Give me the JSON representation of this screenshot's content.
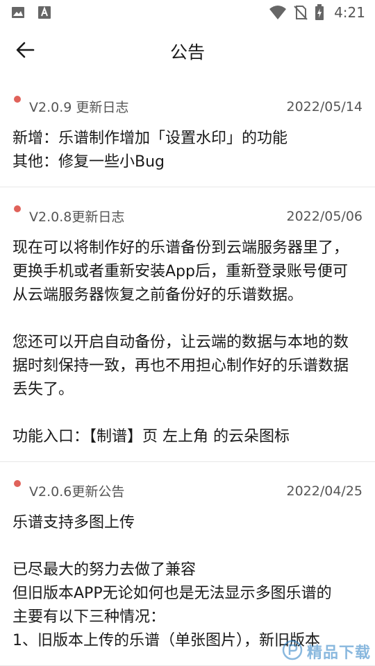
{
  "status_bar": {
    "time": "4:21",
    "icons": [
      "image-icon",
      "a-icon",
      "wifi-icon",
      "no-sim-icon",
      "battery-charging-icon"
    ]
  },
  "header": {
    "title": "公告"
  },
  "notices": [
    {
      "title": "V2.0.9 更新日志",
      "date": "2022/05/14",
      "lines": [
        "新增：乐谱制作增加「设置水印」的功能",
        "其他：修复一些小Bug"
      ]
    },
    {
      "title": "V2.0.8更新日志",
      "date": "2022/05/06",
      "lines": [
        "现在可以将制作好的乐谱备份到云端服务器里了，更换手机或者重新安装App后，重新登录账号便可从云端服务器恢复之前备份好的乐谱数据。",
        "",
        "您还可以开启自动备份，让云端的数据与本地的数据时刻保持一致，再也不用担心制作好的乐谱数据丢失了。",
        "",
        "功能入口：【制谱】页 左上角 的云朵图标"
      ]
    },
    {
      "title": "V2.0.6更新公告",
      "date": "2022/04/25",
      "lines": [
        "乐谱支持多图上传",
        "",
        "已尽最大的努力去做了兼容",
        "但旧版本APP无论如何也是无法显示多图乐谱的",
        "主要有以下三种情况：",
        "1、旧版本上传的乐谱（单张图片），新旧版本"
      ]
    }
  ],
  "watermark": {
    "text": "精品下载"
  },
  "colors": {
    "dot": "#e0625a",
    "text": "#1a1a1a",
    "muted": "#555555",
    "divider": "#e8e8e8"
  }
}
